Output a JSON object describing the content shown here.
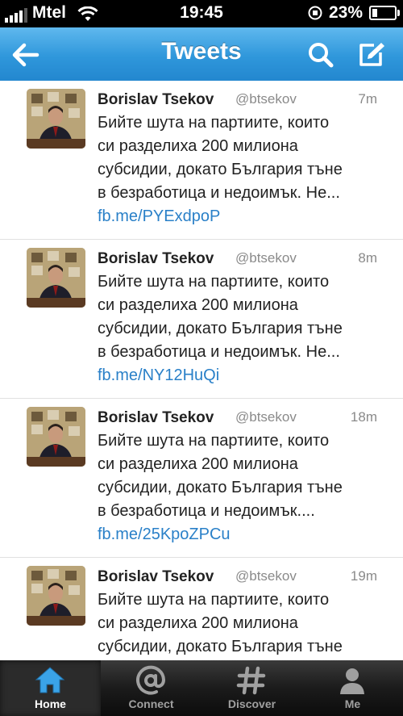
{
  "status_bar": {
    "carrier": "Mtel",
    "time": "19:45",
    "battery_percent": "23%",
    "battery_level": 0.23
  },
  "nav": {
    "title": "Tweets",
    "back_icon": "back-arrow-icon",
    "search_icon": "search-icon",
    "compose_icon": "compose-icon"
  },
  "tweets": [
    {
      "author": "Borislav Tsekov",
      "handle": "@btsekov",
      "time": "7m",
      "lines": [
        "Бийте шута на партиите, които",
        "си разделиха 200 милиона",
        "субсидии, докато България тъне",
        "в безработица и недоимък. Не..."
      ],
      "link": "fb.me/PYExdpoP"
    },
    {
      "author": "Borislav Tsekov",
      "handle": "@btsekov",
      "time": "8m",
      "lines": [
        "Бийте шута на партиите, които",
        "си разделиха 200 милиона",
        "субсидии, докато България тъне",
        "в безработица и недоимък. Не..."
      ],
      "link": "fb.me/NY12HuQi"
    },
    {
      "author": "Borislav Tsekov",
      "handle": "@btsekov",
      "time": "18m",
      "lines": [
        "Бийте шута на партиите, които",
        "си разделиха 200 милиона",
        "субсидии, докато България тъне",
        "в безработица и недоимък...."
      ],
      "link": "fb.me/25KpoZPCu"
    },
    {
      "author": "Borislav Tsekov",
      "handle": "@btsekov",
      "time": "19m",
      "lines": [
        "Бийте шута на партиите, които",
        "си разделиха 200 милиона",
        "субсидии, докато България тъне"
      ],
      "link": ""
    }
  ],
  "tabs": [
    {
      "label": "Home",
      "icon": "home-icon",
      "active": true
    },
    {
      "label": "Connect",
      "icon": "at-sign-icon",
      "active": false
    },
    {
      "label": "Discover",
      "icon": "hash-icon",
      "active": false
    },
    {
      "label": "Me",
      "icon": "person-icon",
      "active": false
    }
  ],
  "colors": {
    "nav_blue": "#2f97db",
    "link_blue": "#2a80c8",
    "active_tab_icon": "#3aa3e8"
  }
}
